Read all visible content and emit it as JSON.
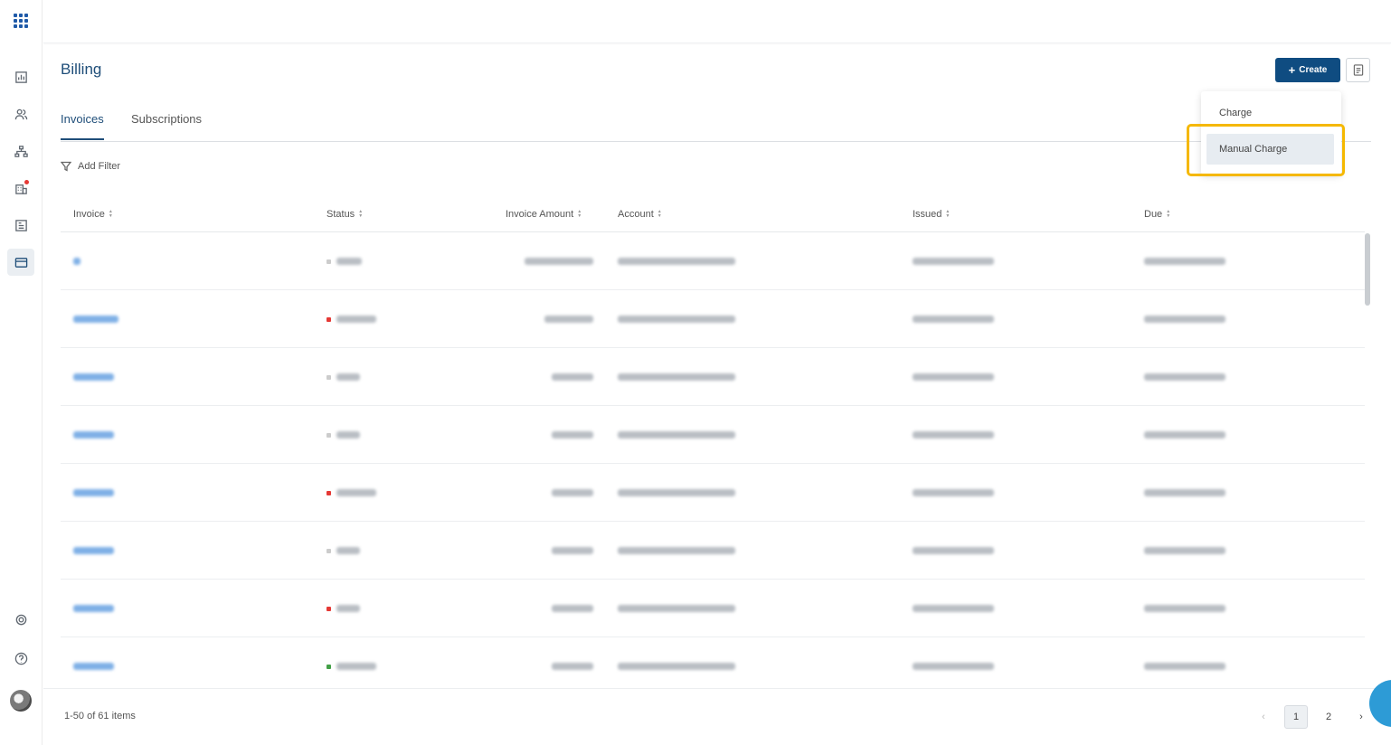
{
  "app": {
    "title": "Billing"
  },
  "sidebar": {
    "items": [
      {
        "name": "apps-grid-icon"
      },
      {
        "name": "dashboard-icon"
      },
      {
        "name": "users-icon"
      },
      {
        "name": "hierarchy-icon"
      },
      {
        "name": "buildings-icon"
      },
      {
        "name": "reports-icon"
      },
      {
        "name": "billing-icon",
        "active": true
      },
      {
        "name": "settings-icon"
      },
      {
        "name": "help-icon"
      }
    ]
  },
  "header": {
    "create_label": "Create",
    "create_plus": "+"
  },
  "tabs": [
    {
      "label": "Invoices",
      "active": true
    },
    {
      "label": "Subscriptions",
      "active": false
    }
  ],
  "filter": {
    "label": "Add Filter"
  },
  "table": {
    "columns": [
      "Invoice",
      "Status",
      "Invoice Amount",
      "Account",
      "Issued",
      "Due"
    ],
    "rows": [
      {
        "status_color": "#cccccc"
      },
      {
        "status_color": "#e53935"
      },
      {
        "status_color": "#cccccc"
      },
      {
        "status_color": "#cccccc"
      },
      {
        "status_color": "#e53935"
      },
      {
        "status_color": "#cccccc"
      },
      {
        "status_color": "#e53935"
      },
      {
        "status_color": "#43a047"
      }
    ]
  },
  "footer": {
    "items_count": "1-50 of 61 items",
    "pages": [
      "1",
      "2"
    ],
    "current_page": "1"
  },
  "create_menu": {
    "items": [
      "Charge",
      "Manual Charge"
    ]
  },
  "colors": {
    "primary": "#0f4c81",
    "highlight": "#f5b800"
  }
}
